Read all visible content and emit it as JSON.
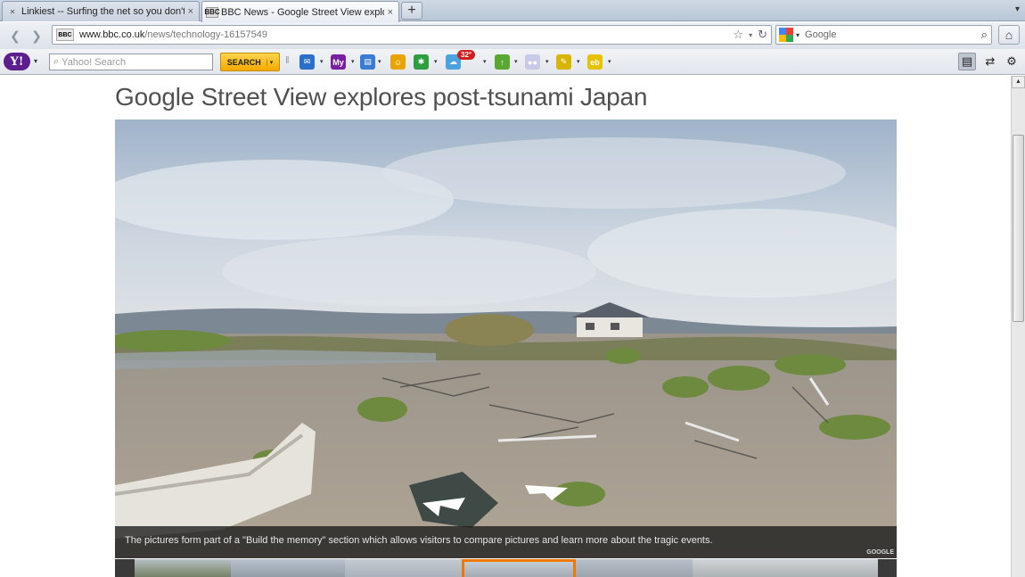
{
  "tabs": [
    {
      "title": "Linkiest -- Surfing the net so you don't ha...",
      "active": false
    },
    {
      "title": "BBC News - Google Street View explores ...",
      "active": true
    }
  ],
  "new_tab_label": "+",
  "tab_menu_label": "▾",
  "nav": {
    "back_label": "❮",
    "forward_label": "❯",
    "site_icon_label": "BBC",
    "url_host": "www.bbc.co.uk",
    "url_path": "/news/technology-16157549",
    "bookmark_star": "☆",
    "dropdown_caret": "▾",
    "reload_label": "↻",
    "search_engine_caret": "▾",
    "search_placeholder": "Google",
    "search_glass": "⌕",
    "home_label": "⌂"
  },
  "yahoo_toolbar": {
    "logo": "Y!",
    "logo_caret": "▾",
    "search_glass": "⌕",
    "search_placeholder": "Yahoo! Search",
    "search_button": "SEARCH",
    "search_caret": "▾",
    "icon_caret": "▾",
    "separator": "‖",
    "weather_badge": "32°",
    "icons": [
      {
        "name": "mail-icon",
        "glyph": "✉",
        "color": "#2a6fc9"
      },
      {
        "name": "my-yahoo-icon",
        "glyph": "My",
        "color": "#7b1fa2"
      },
      {
        "name": "bookmarks-icon",
        "glyph": "▤",
        "color": "#3a7bd5"
      },
      {
        "name": "messenger-icon",
        "glyph": "☺",
        "color": "#e8a400"
      },
      {
        "name": "games-icon",
        "glyph": "✱",
        "color": "#2e9e3e"
      },
      {
        "name": "weather-icon",
        "glyph": "☁",
        "color": "#4aa3df"
      },
      {
        "name": "finance-icon",
        "glyph": "↑",
        "color": "#5aa832"
      },
      {
        "name": "flickr-icon",
        "glyph": "●●",
        "color": "#c9c9e8"
      },
      {
        "name": "notepad-icon",
        "glyph": "✎",
        "color": "#d9b400"
      },
      {
        "name": "ebay-icon",
        "glyph": "eb",
        "color": "#e6c200"
      }
    ],
    "right_icons": [
      {
        "name": "sidebar-icon",
        "glyph": "▤"
      },
      {
        "name": "sync-icon",
        "glyph": "⇄"
      },
      {
        "name": "settings-gear-icon",
        "glyph": "⚙"
      }
    ]
  },
  "article": {
    "headline": "Google Street View explores post-tsunami Japan",
    "caption": "The pictures form part of a \"Build the memory\" section which allows visitors to compare pictures and learn more about the tragic events.",
    "credit": "GOOGLE"
  },
  "scrollbar": {
    "up_arrow": "▲",
    "down_arrow": "▼"
  }
}
